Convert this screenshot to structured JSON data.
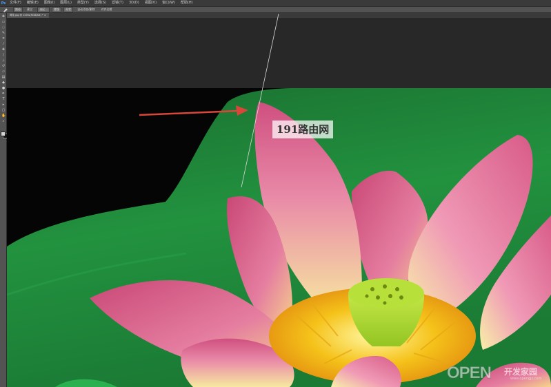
{
  "app": {
    "logo": "Ps"
  },
  "menu": [
    "文件(F)",
    "编辑(E)",
    "图像(I)",
    "图层(L)",
    "类型(Y)",
    "选择(S)",
    "滤镜(T)",
    "3D(D)",
    "视图(V)",
    "窗口(W)",
    "帮助(H)"
  ],
  "options": {
    "tool_preset_icon": "pen-icon",
    "items": [
      "路径",
      "建立:",
      "选区...",
      "蒙版",
      "形状",
      "自动添加/删除",
      "对齐边缘"
    ]
  },
  "document": {
    "tab_title": "荷花.jpg @ 100%(RGB/8#) * ×"
  },
  "toolbar": {
    "tools": [
      "move-tool-icon",
      "marquee-tool-icon",
      "lasso-tool-icon",
      "quick-select-tool-icon",
      "crop-tool-icon",
      "eyedropper-tool-icon",
      "healing-brush-tool-icon",
      "brush-tool-icon",
      "clone-stamp-tool-icon",
      "history-brush-tool-icon",
      "eraser-tool-icon",
      "gradient-tool-icon",
      "blur-tool-icon",
      "dodge-tool-icon",
      "pen-tool-icon",
      "type-tool-icon",
      "path-select-tool-icon",
      "shape-tool-icon",
      "hand-tool-icon",
      "zoom-tool-icon"
    ]
  },
  "canvas": {
    "colors": {
      "background": "#282828",
      "leaf_green": "#1f8a3a",
      "petal_pink": "#d65a88",
      "petal_light": "#f3a7c1",
      "stamen_yellow": "#f5c21a",
      "receptacle_green": "#b9e23a",
      "arrow_red": "#d9473b"
    }
  },
  "watermarks": {
    "router": "191路由网",
    "open_text": "OPEN",
    "open_cn": "开发家园",
    "open_url": "www.opengjz.com"
  }
}
